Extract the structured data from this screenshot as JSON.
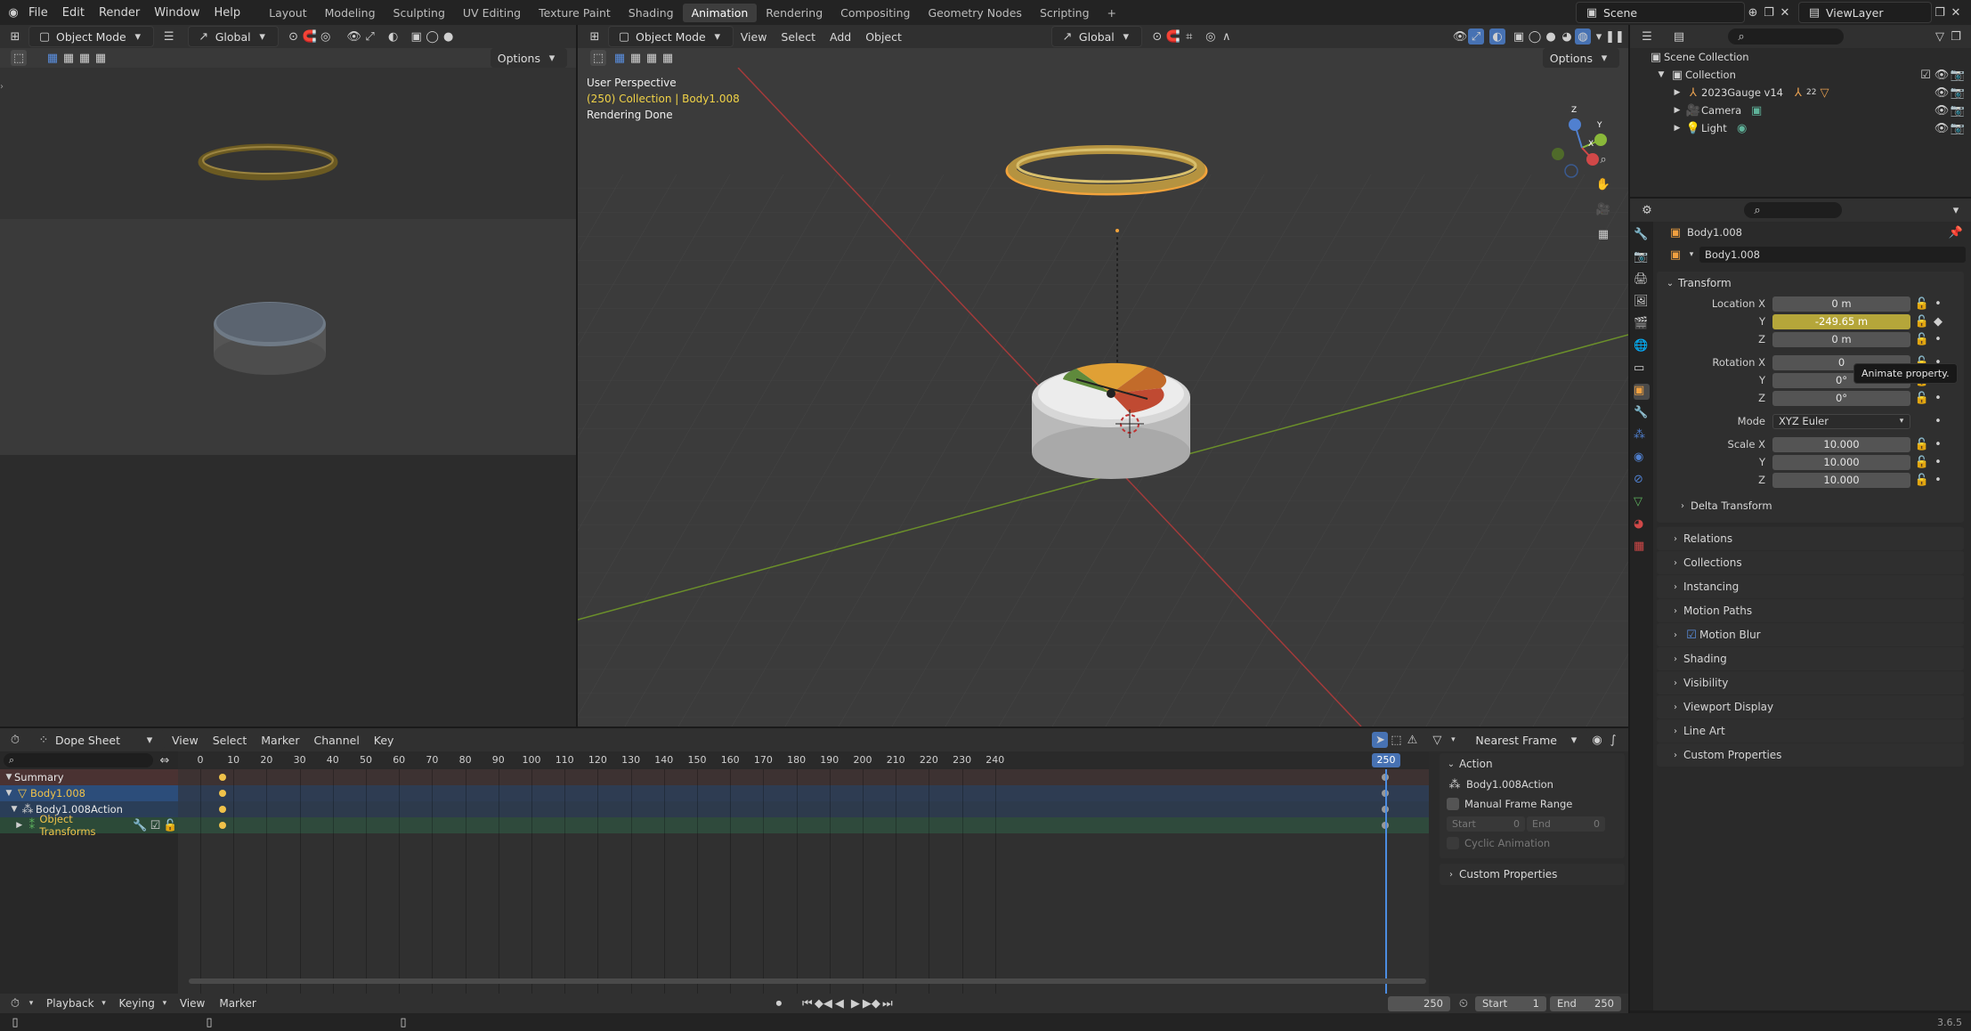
{
  "topbar": {
    "menus": [
      "File",
      "Edit",
      "Render",
      "Window",
      "Help"
    ],
    "workspaces": [
      "Layout",
      "Modeling",
      "Sculpting",
      "UV Editing",
      "Texture Paint",
      "Shading",
      "Animation",
      "Rendering",
      "Compositing",
      "Geometry Nodes",
      "Scripting"
    ],
    "active_workspace": "Animation",
    "add_workspace": "+",
    "scene_label": "Scene",
    "viewlayer_label": "ViewLayer"
  },
  "left_view": {
    "mode": "Object Mode",
    "transform": "Global",
    "options": "Options"
  },
  "main_view": {
    "mode": "Object Mode",
    "menus": [
      "View",
      "Select",
      "Add",
      "Object"
    ],
    "transform": "Global",
    "options": "Options",
    "overlay_line1": "User Perspective",
    "overlay_line2": "(250) Collection | Body1.008",
    "overlay_line3": "Rendering Done",
    "gizmo_axes": [
      "X",
      "Y",
      "Z"
    ]
  },
  "outliner": {
    "scene_collection": "Scene Collection",
    "collection": "Collection",
    "items": [
      {
        "label": "2023Gauge v14",
        "badge": "22"
      },
      {
        "label": "Camera"
      },
      {
        "label": "Light"
      }
    ]
  },
  "properties": {
    "object_name": "Body1.008",
    "object_field": "Body1.008",
    "transform_title": "Transform",
    "location": [
      {
        "label": "Location X",
        "value": "0 m"
      },
      {
        "label": "Y",
        "value": "-249.65 m",
        "animated": true
      },
      {
        "label": "Z",
        "value": "0 m"
      }
    ],
    "rotation": [
      {
        "label": "Rotation X",
        "value": "0"
      },
      {
        "label": "Y",
        "value": "0°"
      },
      {
        "label": "Z",
        "value": "0°"
      }
    ],
    "mode_label": "Mode",
    "mode_value": "XYZ Euler",
    "scale": [
      {
        "label": "Scale X",
        "value": "10.000"
      },
      {
        "label": "Y",
        "value": "10.000"
      },
      {
        "label": "Z",
        "value": "10.000"
      }
    ],
    "delta_transform": "Delta Transform",
    "tooltip": "Animate property.",
    "panels": [
      "Relations",
      "Collections",
      "Instancing",
      "Motion Paths",
      "Motion Blur",
      "Shading",
      "Visibility",
      "Viewport Display",
      "Line Art",
      "Custom Properties"
    ]
  },
  "dopesheet": {
    "editor": "Dope Sheet",
    "menus": [
      "View",
      "Select",
      "Marker",
      "Channel",
      "Key"
    ],
    "snap": "Nearest Frame",
    "frame_ticks": [
      "0",
      "10",
      "20",
      "30",
      "40",
      "50",
      "60",
      "70",
      "80",
      "90",
      "100",
      "110",
      "120",
      "130",
      "140",
      "150",
      "160",
      "170",
      "180",
      "190",
      "200",
      "210",
      "220",
      "230",
      "240"
    ],
    "current_frame_label": "250",
    "channels": [
      "Summary",
      "Body1.008",
      "Body1.008Action",
      "Object Transforms"
    ],
    "action_panel": {
      "title": "Action",
      "action_name": "Body1.008Action",
      "manual_range": "Manual Frame Range",
      "start_label": "Start",
      "start_value": "0",
      "end_label": "End",
      "end_value": "0",
      "cyclic": "Cyclic Animation",
      "custom_props": "Custom Properties"
    }
  },
  "timeline": {
    "menus": [
      "Playback",
      "Keying",
      "View",
      "Marker"
    ],
    "current_frame": "250",
    "start_label": "Start",
    "start_value": "1",
    "end_label": "End",
    "end_value": "250"
  },
  "statusbar": {
    "version": "3.6.5"
  }
}
